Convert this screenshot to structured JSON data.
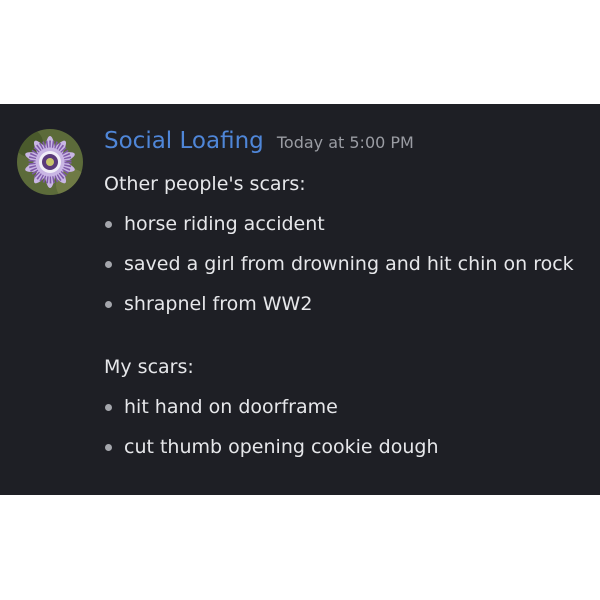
{
  "message": {
    "username": "Social Loafing",
    "timestamp": "Today at 5:00 PM",
    "avatar_icon": "passion-flower-avatar",
    "sections": [
      {
        "heading": "Other people's scars:",
        "items": [
          "horse riding accident",
          "saved a girl from drowning and hit chin on rock",
          "shrapnel from WW2"
        ]
      },
      {
        "heading": "My scars:",
        "items": [
          "hit hand on doorframe",
          "cut thumb opening cookie dough"
        ]
      }
    ]
  },
  "colors": {
    "panel_background": "#1e1f25",
    "username": "#4f86d8",
    "text": "#e6e7ea",
    "timestamp": "#9a9ca3"
  }
}
